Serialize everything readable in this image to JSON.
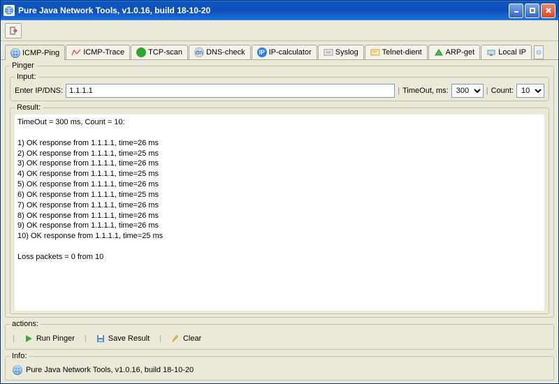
{
  "window": {
    "title": "Pure Java Network Tools,  v1.0.16, build 18-10-20"
  },
  "tabs": [
    {
      "label": "ICMP-Ping",
      "icon": "globe-icon",
      "active": true
    },
    {
      "label": "ICMP-Trace",
      "icon": "trace-icon"
    },
    {
      "label": "TCP-scan",
      "icon": "green-dot-icon"
    },
    {
      "label": "DNS-check",
      "icon": "dns-icon"
    },
    {
      "label": "IP-calculator",
      "icon": "ip-icon"
    },
    {
      "label": "Syslog",
      "icon": "syslog-icon"
    },
    {
      "label": "Telnet-dient",
      "icon": "telnet-icon"
    },
    {
      "label": "ARP-get",
      "icon": "arp-icon"
    },
    {
      "label": "Local IP",
      "icon": "localip-icon"
    }
  ],
  "pinger": {
    "legend": "Pinger",
    "input_legend": "Input:",
    "ip_label": "Enter IP/DNS:",
    "ip_value": "1.1.1.1",
    "timeout_label": "TimeOut, ms:",
    "timeout_value": "300",
    "count_label": "Count:",
    "count_value": "10"
  },
  "result": {
    "legend": "Result:",
    "text": "TimeOut = 300 ms, Count = 10:\n\n1) OK response from 1.1.1.1, time=26 ms\n2) OK response from 1.1.1.1, time=25 ms\n3) OK response from 1.1.1.1, time=26 ms\n4) OK response from 1.1.1.1, time=25 ms\n5) OK response from 1.1.1.1, time=26 ms\n6) OK response from 1.1.1.1, time=25 ms\n7) OK response from 1.1.1.1, time=26 ms\n8) OK response from 1.1.1.1, time=26 ms\n9) OK response from 1.1.1.1, time=26 ms\n10) OK response from 1.1.1.1, time=25 ms\n\nLoss packets = 0 from 10"
  },
  "actions": {
    "legend": "actions:",
    "run": "Run Pinger",
    "save": "Save Result",
    "clear": "Clear"
  },
  "info": {
    "legend": "Info:",
    "text": "Pure Java Network Tools,  v1.0.16, build 18-10-20"
  }
}
